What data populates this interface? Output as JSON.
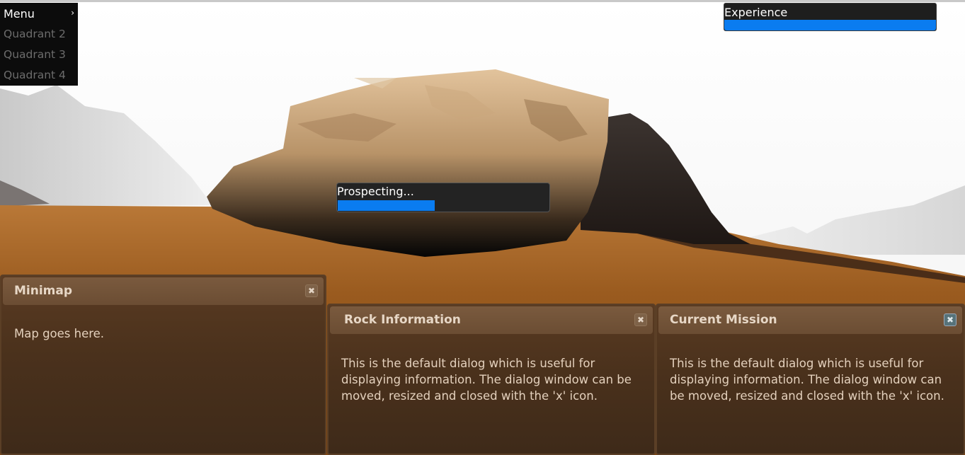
{
  "menu": {
    "title": "Menu",
    "items": [
      {
        "label": "Quadrant 2"
      },
      {
        "label": "Quadrant 3"
      },
      {
        "label": "Quadrant 4"
      }
    ]
  },
  "experience": {
    "label": "Experience",
    "progress": 1.0,
    "color": "#0a7cf0"
  },
  "prospecting": {
    "label": "Prospecting...",
    "progress": 0.46,
    "color": "#0a7cf0"
  },
  "dialogs": {
    "minimap": {
      "title": "Minimap",
      "body": "Map goes here.",
      "close_icon": "close-icon"
    },
    "rock_info": {
      "title": "Rock Information",
      "body": "This is the default dialog which is useful for displaying information. The dialog window can be moved, resized and closed with the 'x' icon.",
      "close_icon": "close-icon"
    },
    "current_mission": {
      "title": "Current Mission",
      "body": "This is the default dialog which is useful for displaying information. The dialog window can be moved, resized and closed with the 'x' icon.",
      "close_icon": "close-icon"
    }
  },
  "colors": {
    "ground": "#9a5a1e",
    "sky": "#f7f7f7",
    "dialog_bg": "#4a311c",
    "dialog_title_bg": "#6b4d33"
  }
}
